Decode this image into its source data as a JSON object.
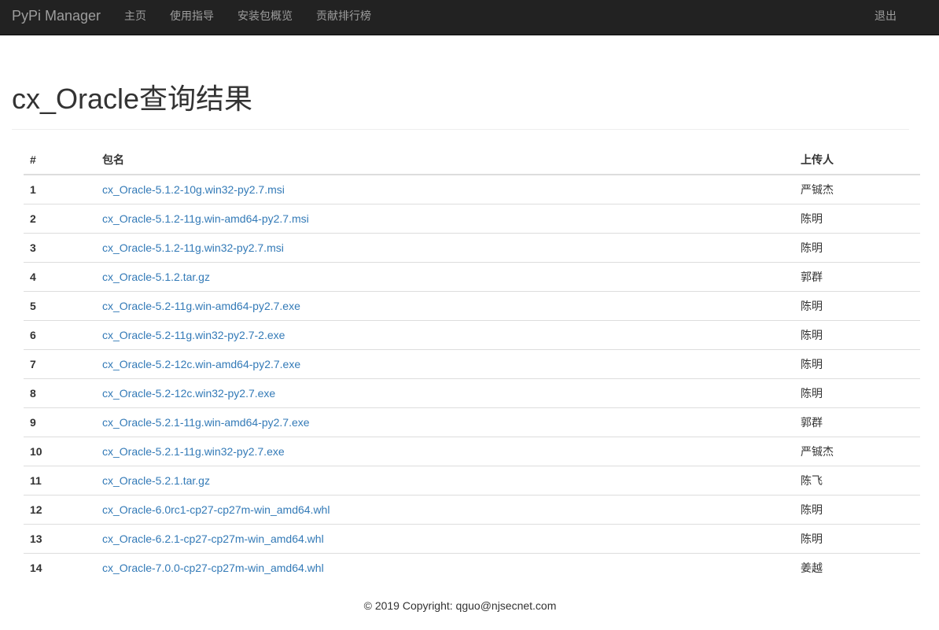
{
  "navbar": {
    "brand": "PyPi Manager",
    "items": [
      {
        "label": "主页"
      },
      {
        "label": "使用指导"
      },
      {
        "label": "安装包概览"
      },
      {
        "label": "贡献排行榜"
      }
    ],
    "logout": "退出"
  },
  "page": {
    "title": "cx_Oracle查询结果"
  },
  "table": {
    "headers": [
      "#",
      "包名",
      "上传人"
    ],
    "rows": [
      {
        "index": "1",
        "package": "cx_Oracle-5.1.2-10g.win32-py2.7.msi",
        "uploader": "严铖杰"
      },
      {
        "index": "2",
        "package": "cx_Oracle-5.1.2-11g.win-amd64-py2.7.msi",
        "uploader": "陈明"
      },
      {
        "index": "3",
        "package": "cx_Oracle-5.1.2-11g.win32-py2.7.msi",
        "uploader": "陈明"
      },
      {
        "index": "4",
        "package": "cx_Oracle-5.1.2.tar.gz",
        "uploader": "郭群"
      },
      {
        "index": "5",
        "package": "cx_Oracle-5.2-11g.win-amd64-py2.7.exe",
        "uploader": "陈明"
      },
      {
        "index": "6",
        "package": "cx_Oracle-5.2-11g.win32-py2.7-2.exe",
        "uploader": "陈明"
      },
      {
        "index": "7",
        "package": "cx_Oracle-5.2-12c.win-amd64-py2.7.exe",
        "uploader": "陈明"
      },
      {
        "index": "8",
        "package": "cx_Oracle-5.2-12c.win32-py2.7.exe",
        "uploader": "陈明"
      },
      {
        "index": "9",
        "package": "cx_Oracle-5.2.1-11g.win-amd64-py2.7.exe",
        "uploader": "郭群"
      },
      {
        "index": "10",
        "package": "cx_Oracle-5.2.1-11g.win32-py2.7.exe",
        "uploader": "严铖杰"
      },
      {
        "index": "11",
        "package": "cx_Oracle-5.2.1.tar.gz",
        "uploader": "陈飞"
      },
      {
        "index": "12",
        "package": "cx_Oracle-6.0rc1-cp27-cp27m-win_amd64.whl",
        "uploader": "陈明"
      },
      {
        "index": "13",
        "package": "cx_Oracle-6.2.1-cp27-cp27m-win_amd64.whl",
        "uploader": "陈明"
      },
      {
        "index": "14",
        "package": "cx_Oracle-7.0.0-cp27-cp27m-win_amd64.whl",
        "uploader": "姜越"
      }
    ]
  },
  "footer": {
    "text": "© 2019 Copyright: qguo@njsecnet.com"
  },
  "colors": {
    "navbar_bg": "#222222",
    "navbar_text": "#9d9d9d",
    "link": "#337ab7",
    "text": "#333333",
    "border": "#dddddd"
  }
}
